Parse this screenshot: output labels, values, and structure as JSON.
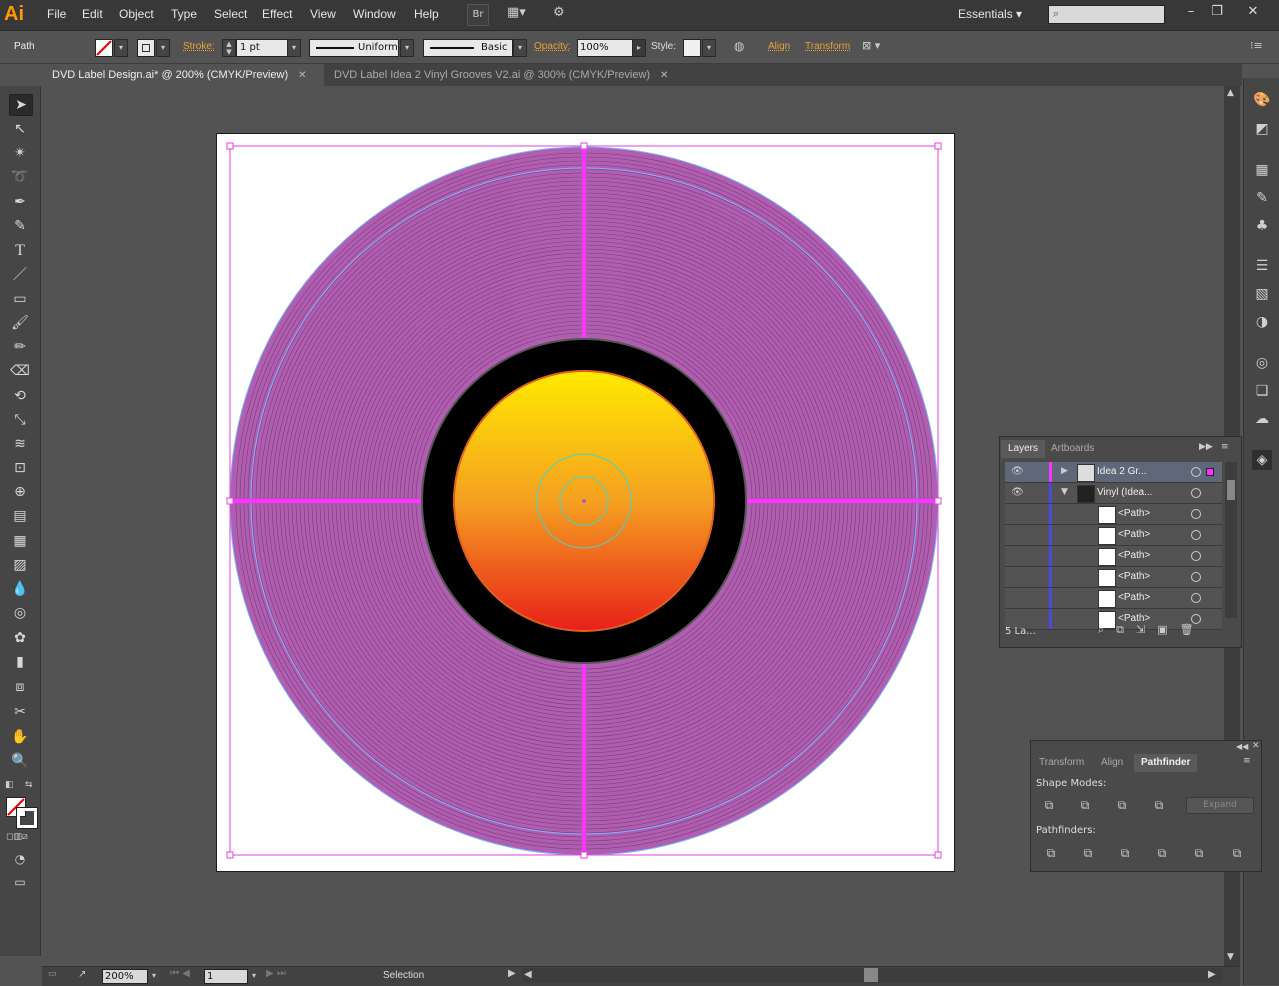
{
  "app": {
    "logo": "Ai"
  },
  "menu": [
    "File",
    "Edit",
    "Object",
    "Type",
    "Select",
    "Effect",
    "View",
    "Window",
    "Help"
  ],
  "menubar_buttons": {
    "bridge": "Br"
  },
  "workspace": {
    "label": "Essentials"
  },
  "control": {
    "selection_type": "Path",
    "stroke_label": "Stroke:",
    "stroke_weight": "1 pt",
    "profile": "Uniform",
    "brush": "Basic",
    "opacity_label": "Opacity:",
    "opacity_value": "100%",
    "style_label": "Style:",
    "align_link": "Align",
    "transform_link": "Transform"
  },
  "tabs": [
    {
      "label": "DVD Label Design.ai* @ 200% (CMYK/Preview)",
      "active": true
    },
    {
      "label": "DVD Label Idea 2 Vinyl Grooves V2.ai @ 300% (CMYK/Preview)",
      "active": false
    }
  ],
  "layers_panel": {
    "tabs": [
      "Layers",
      "Artboards"
    ],
    "rows": [
      {
        "name": "Idea 2 Gr...",
        "selected": true
      },
      {
        "name": "Vinyl (Idea...",
        "selected": false
      },
      {
        "name": "<Path>"
      },
      {
        "name": "<Path>"
      },
      {
        "name": "<Path>"
      },
      {
        "name": "<Path>"
      },
      {
        "name": "<Path>"
      },
      {
        "name": "<Path>"
      }
    ],
    "footer": "5 La..."
  },
  "pathfinder_panel": {
    "tabs": [
      "Transform",
      "Align",
      "Pathfinder"
    ],
    "shape_modes_label": "Shape Modes:",
    "expand_label": "Expand",
    "pathfinders_label": "Pathfinders:"
  },
  "status": {
    "zoom": "200%",
    "artboard_number": "1",
    "tool": "Selection"
  },
  "colors": {
    "accent_orange": "#e8a03a",
    "vinyl_fill": "#b05fb0",
    "label_top": "#ffea00",
    "label_bottom": "#e8201a",
    "guide_magenta": "#ff33ff"
  }
}
